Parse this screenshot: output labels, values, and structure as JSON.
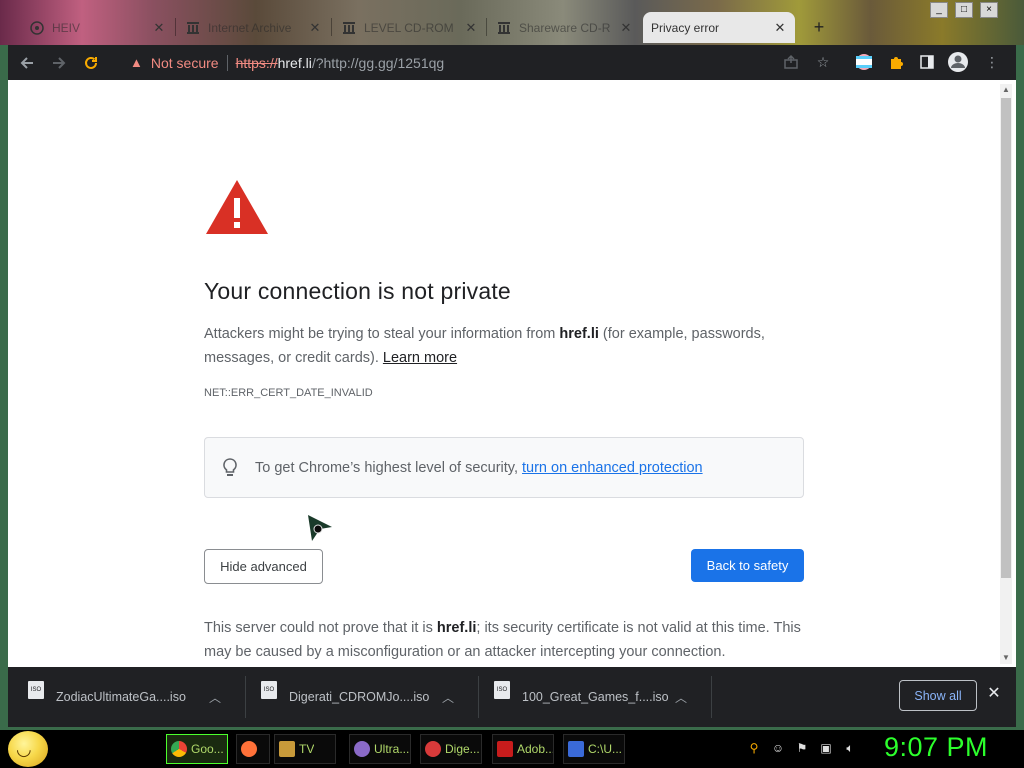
{
  "browser": {
    "tabs": [
      {
        "label": "HEIV",
        "icon": "firefox-like-icon",
        "active": false
      },
      {
        "label": "Internet Archive",
        "icon": "archive-icon",
        "active": false
      },
      {
        "label": "LEVEL CD-ROM",
        "icon": "archive-icon",
        "active": false
      },
      {
        "label": "Shareware CD-R",
        "icon": "archive-icon",
        "active": false
      },
      {
        "label": "Privacy error",
        "icon": "none",
        "active": true
      }
    ],
    "new_tab": "+",
    "window_buttons": {
      "minimize": "_",
      "maximize": "□",
      "close": "×"
    },
    "omnibox": {
      "security_label": "Not secure",
      "url_scheme": "https://",
      "url_host": "href.li",
      "url_rest": "/?http://gg.gg/1251qg"
    }
  },
  "page": {
    "heading": "Your connection is not private",
    "desc_prefix": "Attackers might be trying to steal your information from ",
    "desc_host": "href.li",
    "desc_suffix": " (for example, passwords, messages, or credit cards).",
    "learn_more": "Learn more",
    "error_code": "NET::ERR_CERT_DATE_INVALID",
    "enhanced_text": "To get Chrome’s highest level of security,",
    "enhanced_link": "turn on enhanced protection",
    "hide_advanced": "Hide advanced",
    "back_to_safety": "Back to safety",
    "details_prefix": "This server could not prove that it is ",
    "details_host": "href.li",
    "details_suffix": "; its security certificate is not valid at this time. This may be caused by a misconfiguration or an attacker intercepting your connection."
  },
  "downloads": {
    "items": [
      {
        "name": "ZodiacUltimateGa....iso",
        "icon_label": "ISO"
      },
      {
        "name": "Digerati_CDROMJo....iso",
        "icon_label": "ISO"
      },
      {
        "name": "100_Great_Games_f....iso",
        "icon_label": "ISO"
      }
    ],
    "show_all": "Show all",
    "close": "✕"
  },
  "taskbar": {
    "items": [
      {
        "label": "Goo...",
        "color": "#4285f4",
        "active": true
      },
      {
        "label": "",
        "color": "#ff7139",
        "active": false
      },
      {
        "label": "TV",
        "color": "#c89a3a",
        "active": false
      },
      {
        "label": "Ultra...",
        "color": "#8a6ac8",
        "active": false
      },
      {
        "label": "Dige...",
        "color": "#d83a3a",
        "active": false
      },
      {
        "label": "Adob...",
        "color": "#c81c1c",
        "active": false
      },
      {
        "label": "C:\\U...",
        "color": "#3a6ad8",
        "active": false
      }
    ],
    "clock": "9:07 PM",
    "colors": {
      "clock": "#2cff2c",
      "active_border": "#4cff2c",
      "link": "#1a73e8",
      "error_red": "#f28b82"
    }
  }
}
